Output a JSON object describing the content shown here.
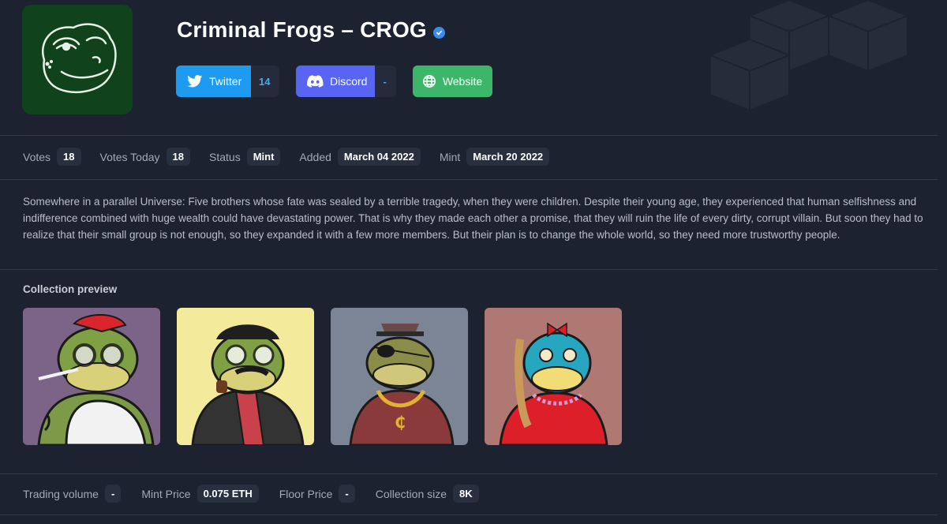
{
  "project": {
    "title": "Criminal Frogs – CROG",
    "verified": true
  },
  "socials": {
    "twitter": {
      "label": "Twitter",
      "count": "14",
      "icon": "twitter-icon"
    },
    "discord": {
      "label": "Discord",
      "count": "-",
      "icon": "discord-icon"
    },
    "website": {
      "label": "Website",
      "icon": "globe-icon"
    }
  },
  "stats": {
    "votes_label": "Votes",
    "votes": "18",
    "votes_today_label": "Votes Today",
    "votes_today": "18",
    "status_label": "Status",
    "status": "Mint",
    "added_label": "Added",
    "added": "March 04 2022",
    "mint_label": "Mint",
    "mint": "March 20 2022"
  },
  "description": "Somewhere in a parallel Universe: Five brothers whose fate was sealed by a terrible tragedy, when they were children. Despite their young age, they experienced that human selfishness and indifference combined with huge wealth could have devastating power. That is why they made each other a promise, that they will ruin the life of every dirty, corrupt villain. But soon they had to realize that their small group is not enough, so they expanded it with a few more members. But their plan is to change the whole world, so they need more trustworthy people.",
  "preview": {
    "title": "Collection preview",
    "items": [
      {
        "bg": "#7c6488"
      },
      {
        "bg": "#f4ea9c"
      },
      {
        "bg": "#7b8595"
      },
      {
        "bg": "#b07872"
      }
    ]
  },
  "market": {
    "trading_volume_label": "Trading volume",
    "trading_volume": "-",
    "mint_price_label": "Mint Price",
    "mint_price": "0.075 ETH",
    "floor_price_label": "Floor Price",
    "floor_price": "-",
    "collection_size_label": "Collection size",
    "collection_size": "8K"
  },
  "colors": {
    "background": "#1d2230",
    "twitter": "#1d9bf0",
    "discord": "#5865f2",
    "website": "#3cb76a",
    "pill": "#283040"
  }
}
